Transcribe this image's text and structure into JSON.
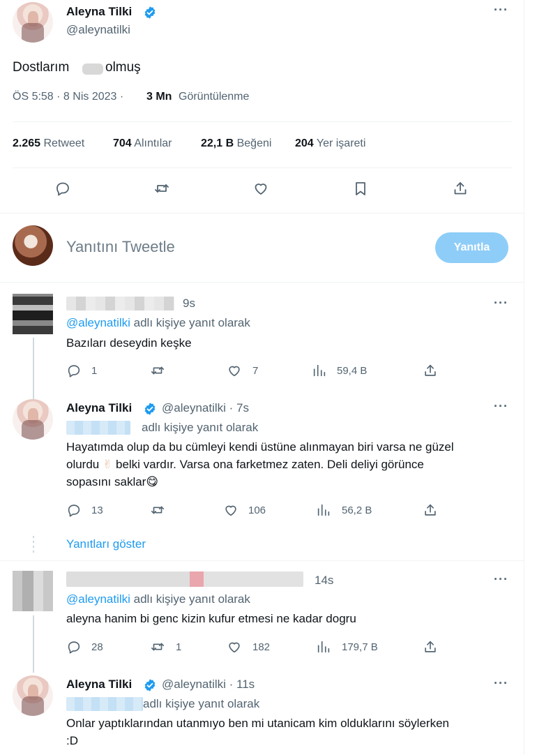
{
  "main_tweet": {
    "author_name": "Aleyna Tilki",
    "author_handle": "@aleynatilki",
    "text_before": "Dostlarım",
    "text_after": "olmuş",
    "time": "ÖS 5:58 · 8 Nis 2023 ·",
    "views_count": "3 Mn",
    "views_label": "Görüntülenme",
    "stats": {
      "retweets_count": "2.265",
      "retweets_label": "Retweet",
      "quotes_count": "704",
      "quotes_label": "Alıntılar",
      "likes_count": "22,1 B",
      "likes_label": "Beğeni",
      "bookmarks_count": "204",
      "bookmarks_label": "Yer işareti"
    }
  },
  "composer": {
    "placeholder": "Yanıtını Tweetle",
    "reply_button": "Yanıtla"
  },
  "replies": [
    {
      "time": "9s",
      "reply_to_handle": "@aleynatilki",
      "reply_to_suffix": "adlı kişiye yanıt olarak",
      "text": "Bazıları deseydin keşke",
      "comments": "1",
      "retweets": "",
      "likes": "7",
      "views": "59,4 B"
    },
    {
      "author_name": "Aleyna Tilki",
      "author_handle_time": "@aleynatilki · 7s",
      "reply_to_suffix": "adlı kişiye yanıt olarak",
      "text_line1": "Hayatımda olup da bu cümleyi kendi üstüne alınmayan biri varsa ne güzel",
      "text_line2_a": "olurdu",
      "text_line2_emoji": "✌",
      "text_line2_b": "belki vardır. Varsa ona farketmez zaten. Deli deliyi görünce",
      "text_line3": "sopasını saklar",
      "text_line3_emoji": "😋",
      "comments": "13",
      "retweets": "",
      "likes": "106",
      "views": "56,2 B",
      "show_replies": "Yanıtları göster"
    },
    {
      "time": "14s",
      "reply_to_handle": "@aleynatilki",
      "reply_to_suffix": "adlı kişiye yanıt olarak",
      "text": "aleyna hanim bi genc kizin kufur etmesi ne kadar dogru",
      "comments": "28",
      "retweets": "1",
      "likes": "182",
      "views": "179,7 B"
    },
    {
      "author_name": "Aleyna Tilki",
      "author_handle_time": "@aleynatilki · 11s",
      "reply_to_suffix": "adlı kişiye yanıt olarak",
      "text_line1": "Onlar yaptıklarından utanmıyo ben mi utanicam kim olduklarını söylerken",
      "text_line2": ":D"
    }
  ],
  "colors": {
    "accent": "#1d9bf0",
    "reply_button_disabled": "#8ecdf8",
    "muted": "#536471",
    "text": "#0f1419"
  },
  "icons": [
    "verified-badge-icon",
    "more-icon",
    "comment-icon",
    "retweet-icon",
    "like-icon",
    "bookmark-icon",
    "share-icon",
    "views-icon"
  ]
}
